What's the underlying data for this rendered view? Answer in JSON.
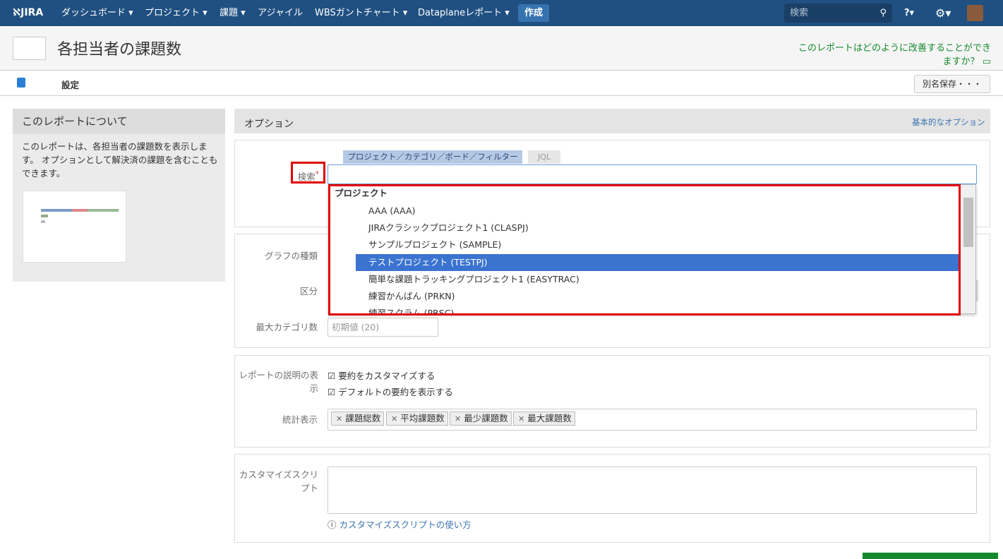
{
  "nav": {
    "logo": "JIRA",
    "items": [
      "ダッシュボード",
      "プロジェクト",
      "課題",
      "アジャイル",
      "WBSガントチャート",
      "Dataplaneレポート"
    ],
    "create": "作成",
    "search_placeholder": "検索"
  },
  "header": {
    "title": "各担当者の課題数",
    "feedback": "このレポートはどのように改善することができますか？"
  },
  "tabs": {
    "settings": "設定",
    "save_as": "別名保存・・・"
  },
  "aside": {
    "title": "このレポートについて",
    "desc": "このレポートは、各担当者の課題数を表示します。 オプションとして解決済の課題を含むこともできます。"
  },
  "options": {
    "title": "オプション",
    "basic": "基本的なオプション",
    "search_tabs": [
      "プロジェクト／カテゴリ／ボード／フィルター",
      "JQL"
    ],
    "search_label": "検索",
    "dropdown": {
      "group": "プロジェクト",
      "items": [
        "AAA (AAA)",
        "JIRAクラシックプロジェクト1 (CLASPJ)",
        "サンプルプロジェクト (SAMPLE)",
        "テストプロジェクト (TESTPJ)",
        "簡単な課題トラッキングプロジェクト1 (EASYTRAC)",
        "練習かんばん (PRKN)",
        "練習スクラム (PRSC)"
      ]
    },
    "graph_type": "グラフの種類",
    "division": "区分",
    "max_cat": "最大カテゴリ数",
    "max_cat_placeholder": "初期値 (20)",
    "report_desc": "レポートの説明の表示",
    "cb1": "要約をカスタマイズする",
    "cb2": "デフォルトの要約を表示する",
    "stats": "統計表示",
    "tags": [
      "課題総数",
      "平均課題数",
      "最少課題数",
      "最大課題数"
    ],
    "script": "カスタマイズスクリプト",
    "script_help": "カスタマイズスクリプトの使い方"
  }
}
